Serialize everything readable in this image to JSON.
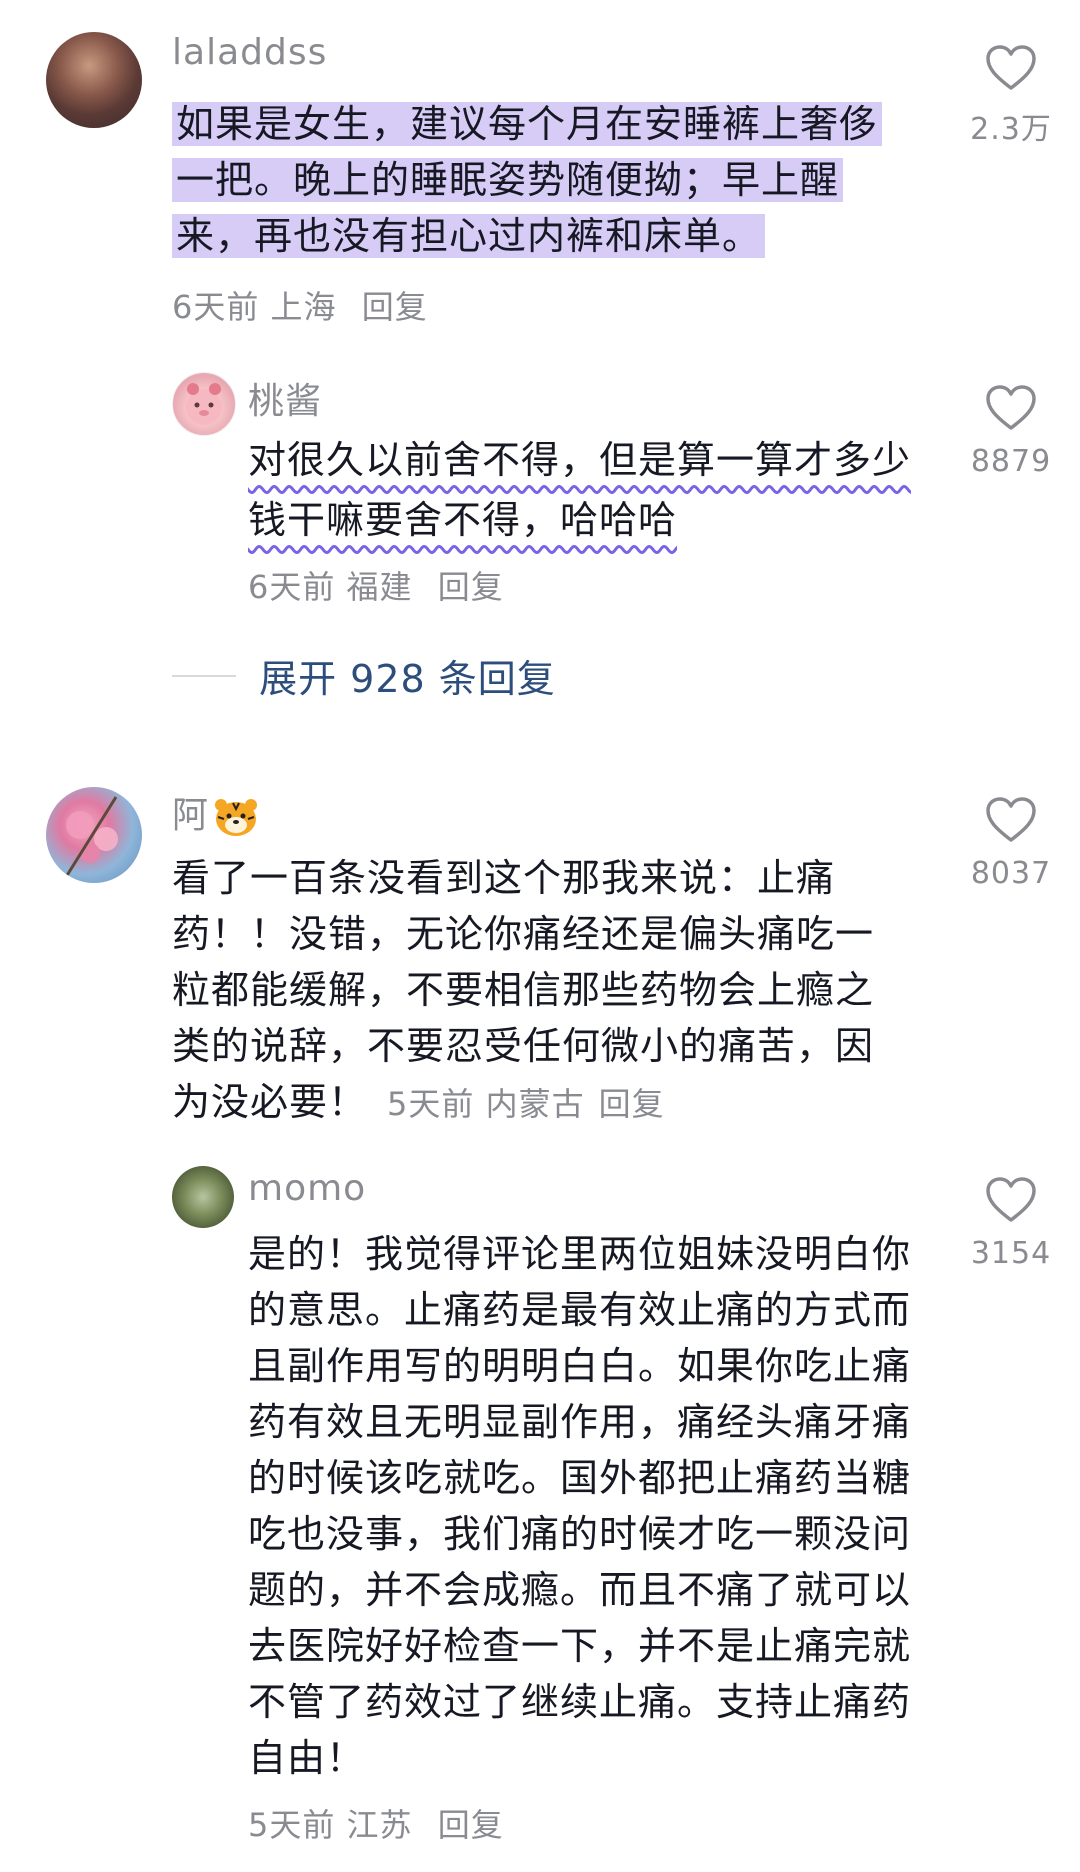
{
  "comments": [
    {
      "username": "laladdss",
      "text": "如果是女生，建议每个月在安睡裤上奢侈一把。晚上的睡眠姿势随便拗；早上醒来，再也没有担心过内裤和床单。",
      "time": "6天前",
      "location": "上海",
      "reply_label": "回复",
      "likes": "2.3万",
      "avatar": "avatar-photo"
    },
    {
      "username": "桃酱",
      "text": "对很久以前舍不得，但是算一算才多少钱干嘛要舍不得，哈哈哈",
      "time": "6天前",
      "location": "福建",
      "reply_label": "回复",
      "likes": "8879",
      "avatar": "avatar-cartoon"
    },
    {
      "username": "阿",
      "username_emoji": "tiger-emoji",
      "text": "看了一百条没看到这个那我来说：止痛药！！没错，无论你痛经还是偏头痛吃一粒都能缓解，不要相信那些药物会上瘾之类的说辞，不要忍受任何微小的痛苦，因为没必要！",
      "time": "5天前",
      "location": "内蒙古",
      "reply_label": "回复",
      "likes": "8037",
      "avatar": "avatar-flowers"
    },
    {
      "username": "momo",
      "text": "是的！我觉得评论里两位姐妹没明白你的意思。止痛药是最有效止痛的方式而且副作用写的明明白白。如果你吃止痛药有效且无明显副作用，痛经头痛牙痛的时候该吃就吃。国外都把止痛药当糖吃也没事，我们痛的时候才吃一颗没问题的，并不会成瘾。而且不痛了就可以去医院好好检查一下，并不是止痛完就不管了药效过了继续止痛。支持止痛药自由！",
      "time": "5天前",
      "location": "江苏",
      "reply_label": "回复",
      "likes": "3154",
      "avatar": "avatar-plant"
    }
  ],
  "expand_replies": "展开 928 条回复",
  "colors": {
    "highlight": "#d6ccf6",
    "wavy_underline": "#7b63e6",
    "link": "#2d4d7c",
    "muted": "#8a8b91",
    "text": "#161823"
  }
}
